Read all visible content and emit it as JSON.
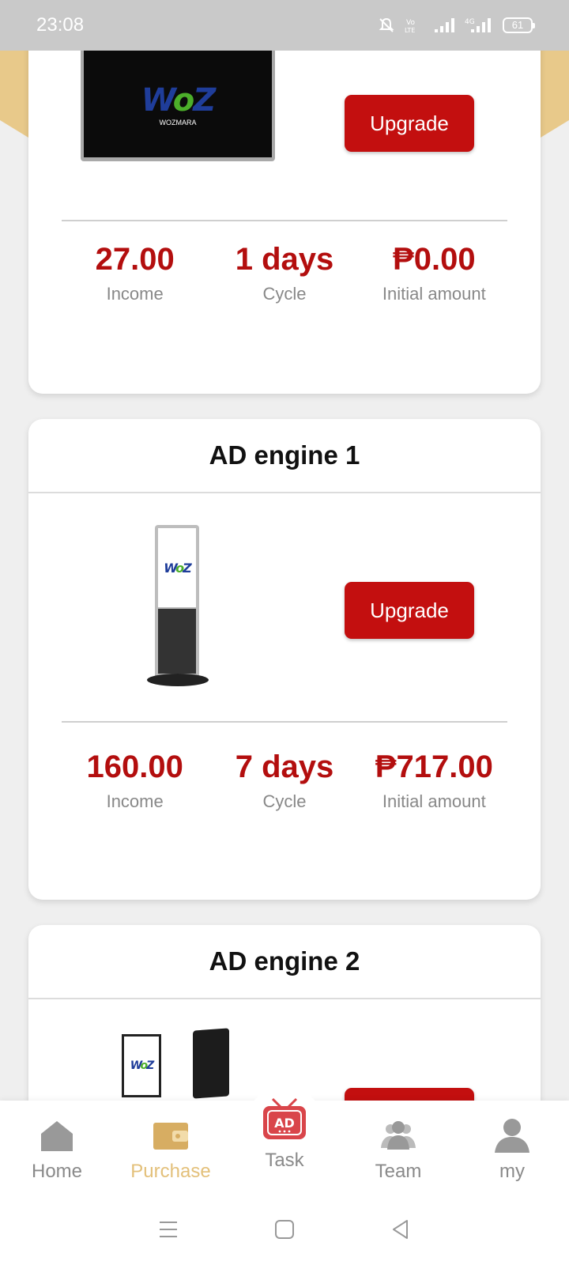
{
  "status_bar": {
    "time": "23:08",
    "battery": "61"
  },
  "cards": [
    {
      "upgrade_label": "Upgrade",
      "stats": [
        {
          "value": "27.00",
          "label": "Income"
        },
        {
          "value": "1 days",
          "label": "Cycle"
        },
        {
          "value": "₱0.00",
          "label": "Initial amount"
        }
      ],
      "logo_sub": "WOZMARA"
    },
    {
      "title": "AD engine 1",
      "upgrade_label": "Upgrade",
      "stats": [
        {
          "value": "160.00",
          "label": "Income"
        },
        {
          "value": "7 days",
          "label": "Cycle"
        },
        {
          "value": "₱717.00",
          "label": "Initial amount"
        }
      ]
    },
    {
      "title": "AD engine 2"
    }
  ],
  "bottom_nav": [
    {
      "label": "Home",
      "icon": "home-icon"
    },
    {
      "label": "Purchase",
      "icon": "wallet-icon",
      "active": true
    },
    {
      "label": "Task",
      "icon": "ad-tv-icon"
    },
    {
      "label": "Team",
      "icon": "team-icon"
    },
    {
      "label": "my",
      "icon": "user-icon"
    }
  ],
  "colors": {
    "accent_red": "#c30f0f",
    "value_red": "#b30e0e",
    "gold": "#e3c07a"
  }
}
